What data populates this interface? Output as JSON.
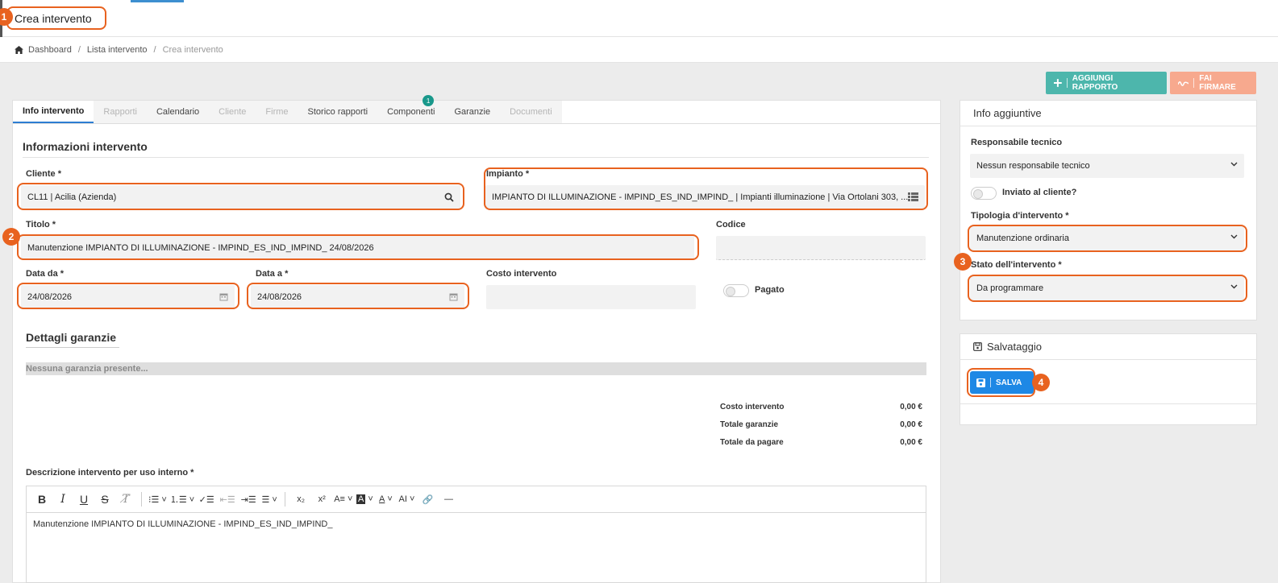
{
  "header": {
    "title": "Crea intervento"
  },
  "breadcrumb": {
    "home": "Dashboard",
    "list": "Lista intervento",
    "current": "Crea intervento",
    "separator": "/"
  },
  "actions": {
    "add_report": "AGGIUNGI RAPPORTO",
    "sign": "FAI FIRMARE"
  },
  "tabs": [
    {
      "label": "Info intervento",
      "state": "active"
    },
    {
      "label": "Rapporti",
      "state": "disabled"
    },
    {
      "label": "Calendario",
      "state": "normal"
    },
    {
      "label": "Cliente",
      "state": "disabled"
    },
    {
      "label": "Firme",
      "state": "disabled"
    },
    {
      "label": "Storico rapporti",
      "state": "normal"
    },
    {
      "label": "Componenti",
      "state": "normal",
      "badge": "1"
    },
    {
      "label": "Garanzie",
      "state": "normal"
    },
    {
      "label": "Documenti",
      "state": "disabled"
    }
  ],
  "form": {
    "section_title": "Informazioni intervento",
    "cliente": {
      "label": "Cliente *",
      "value": "CL11 | Acilia (Azienda)"
    },
    "impianto": {
      "label": "Impianto *",
      "value": "IMPIANTO DI ILLUMINAZIONE - IMPIND_ES_IND_IMPIND_ | Impianti illuminazione | Via Ortolani 303, ..."
    },
    "titolo": {
      "label": "Titolo *",
      "value": "Manutenzione IMPIANTO DI ILLUMINAZIONE - IMPIND_ES_IND_IMPIND_ 24/08/2026"
    },
    "codice": {
      "label": "Codice",
      "value": ""
    },
    "data_da": {
      "label": "Data da *",
      "value": "24/08/2026"
    },
    "data_a": {
      "label": "Data a *",
      "value": "24/08/2026"
    },
    "costo": {
      "label": "Costo intervento",
      "value": ""
    },
    "pagato": {
      "label": "Pagato",
      "checked": false
    }
  },
  "garanzie": {
    "title": "Dettagli garanzie",
    "empty": "Nessuna garanzia presente..."
  },
  "totals": [
    {
      "label": "Costo intervento",
      "value": "0,00 €"
    },
    {
      "label": "Totale garanzie",
      "value": "0,00 €"
    },
    {
      "label": "Totale da pagare",
      "value": "0,00 €"
    }
  ],
  "descrizione": {
    "label": "Descrizione intervento per uso interno *",
    "content": "Manutenzione IMPIANTO DI ILLUMINAZIONE - IMPIND_ES_IND_IMPIND_",
    "toolbar": [
      "bold",
      "italic",
      "underline",
      "strikethrough",
      "clear-format",
      "bulleted-list",
      "numbered-list",
      "todo-list",
      "outdent",
      "indent",
      "align",
      "subscript",
      "superscript",
      "text-style",
      "highlight",
      "font-color",
      "font-size",
      "link",
      "horizontal-line"
    ]
  },
  "info_aggiuntive": {
    "title": "Info aggiuntive",
    "responsabile": {
      "label": "Responsabile tecnico",
      "value": "Nessun responsabile tecnico"
    },
    "inviato": {
      "label": "Inviato al cliente?",
      "checked": false
    },
    "tipologia": {
      "label": "Tipologia d'intervento *",
      "value": "Manutenzione ordinaria"
    },
    "stato": {
      "label": "Stato dell'intervento *",
      "value": "Da programmare"
    }
  },
  "salvataggio": {
    "title": "Salvataggio",
    "save_label": "SALVA"
  },
  "markers": [
    "1",
    "2",
    "3",
    "4"
  ],
  "colors": {
    "accent": "#e8621f",
    "primary": "#1e88e5",
    "teal": "#4db6ac",
    "salmon": "#f7a98e",
    "badge": "#19988b"
  }
}
